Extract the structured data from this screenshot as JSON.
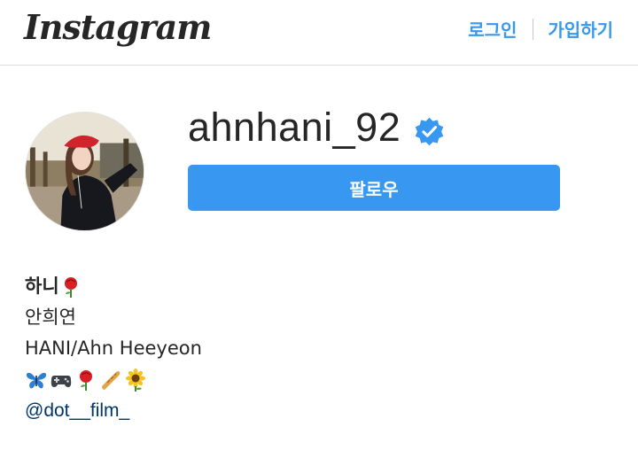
{
  "header": {
    "logo_text": "Instagram",
    "login_label": "로그인",
    "signup_label": "가입하기"
  },
  "profile": {
    "username": "ahnhani_92",
    "verified": true,
    "follow_label": "팔로우"
  },
  "bio": {
    "name": "하니",
    "name_emoji": "rose-icon",
    "line1": "안희연",
    "line2": "HANI/Ahn Heeyeon",
    "emojis": [
      "butterfly-icon",
      "gamepad-icon",
      "rose-icon",
      "baguette-icon",
      "sunflower-icon"
    ],
    "link": "@dot__film_"
  },
  "colors": {
    "accent": "#3897f0",
    "link": "#003569",
    "text": "#262626",
    "border": "#dbdbdb"
  }
}
